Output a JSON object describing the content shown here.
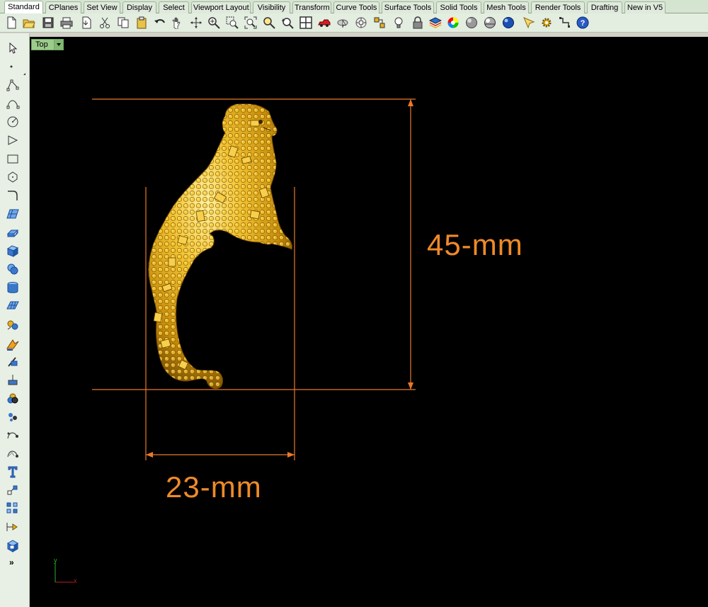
{
  "tabs": [
    "Standard",
    "CPlanes",
    "Set View",
    "Display",
    "Select",
    "Viewport Layout",
    "Visibility",
    "Transform",
    "Curve Tools",
    "Surface Tools",
    "Solid Tools",
    "Mesh Tools",
    "Render Tools",
    "Drafting",
    "New in V5"
  ],
  "viewport": {
    "name": "Top"
  },
  "dimensions": {
    "height_label": "45-mm",
    "width_label": "23-mm"
  },
  "axes": {
    "x_label": "x",
    "y_label": "y"
  },
  "left_more": "»",
  "colors": {
    "dimension": "#f08a28",
    "model_gold": "#e0a21a",
    "viewport_bg": "#000000",
    "tab_active": "#ffffff",
    "viewport_label_bg": "#9ccc8c"
  },
  "toolbar_icons": [
    "new-icon",
    "open-icon",
    "save-icon",
    "print-icon",
    "import-icon",
    "cut-icon",
    "copy-icon",
    "paste-icon",
    "undo-icon",
    "pan-icon",
    "rotate-view-icon",
    "zoom-dynamic-icon",
    "zoom-window-icon",
    "zoom-extents-icon",
    "zoom-selected-icon",
    "undo-view-icon",
    "four-viewports-icon",
    "car-icon",
    "select-icon",
    "snap-icon",
    "properties-icon",
    "light-icon",
    "lock-icon",
    "layer-icon",
    "color-icon",
    "shaded-icon",
    "rendered-icon",
    "render-sphere-icon",
    "pointer-icon",
    "options-icon",
    "grid-snap-icon",
    "help-icon"
  ],
  "left_icons": [
    "select-arrow-icon",
    "point-icon",
    "polyline-icon",
    "curve-icon",
    "circle-icon",
    "arc-icon",
    "rectangle-icon",
    "polygon-icon",
    "fillet-curve-icon",
    "surface-icon",
    "extrude-icon",
    "box-icon",
    "boolean-icon",
    "cylinder-icon",
    "mesh-icon",
    "transform-icon",
    "explode-icon",
    "split-icon",
    "trim-icon",
    "solid-tools-icon",
    "group-icon",
    "point-edit-icon",
    "curve-edit-icon",
    "text-icon",
    "block-icon",
    "array-icon",
    "dimension-icon",
    "render-box-icon"
  ]
}
